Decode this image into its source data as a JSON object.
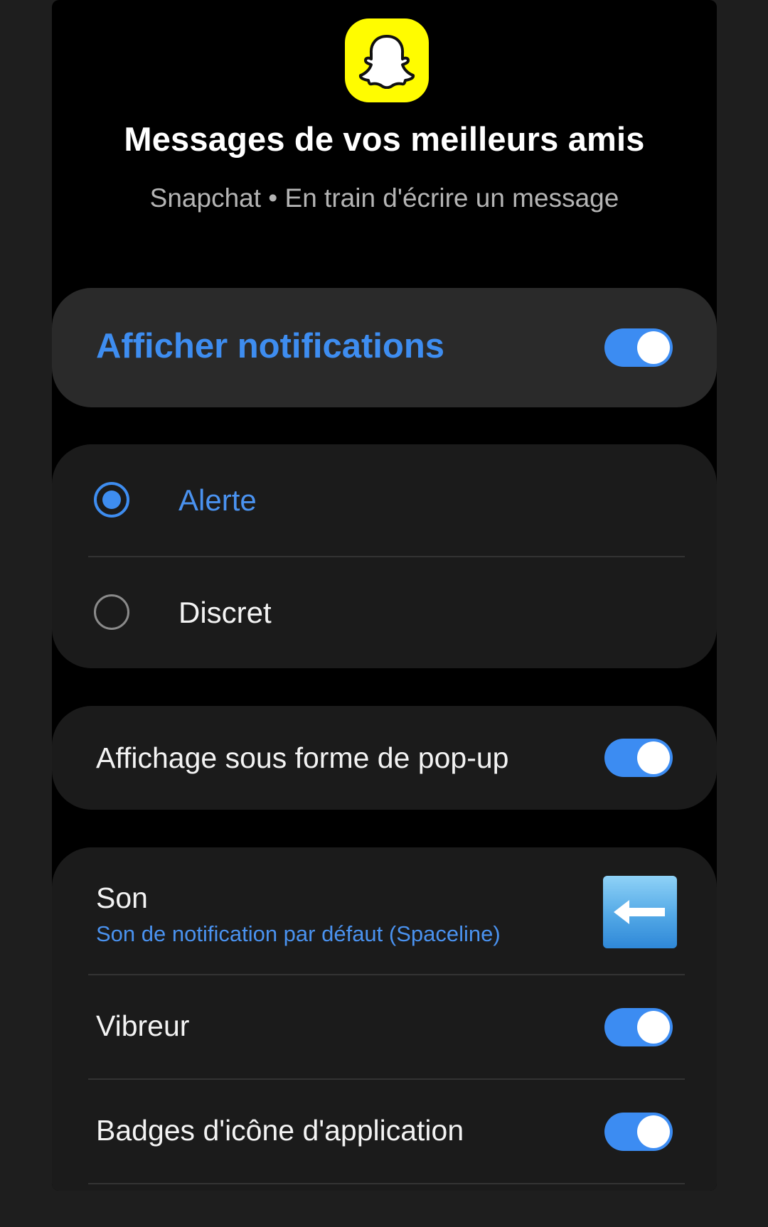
{
  "app": {
    "name": "Snapchat",
    "icon": "snapchat-ghost-icon",
    "brand_color": "#fffc00"
  },
  "header": {
    "title": "Messages de vos meilleurs amis",
    "subtitle": "Snapchat • En train d'écrire un message"
  },
  "master_toggle": {
    "label": "Afficher notifications",
    "on": true
  },
  "alert_mode": {
    "options": [
      {
        "label": "Alerte",
        "selected": true
      },
      {
        "label": "Discret",
        "selected": false
      }
    ]
  },
  "popup": {
    "label": "Affichage sous forme de pop-up",
    "on": true
  },
  "sound": {
    "label": "Son",
    "value": "Son de notification par défaut (Spaceline)",
    "icon": "left-arrow-emoji-icon"
  },
  "vibration": {
    "label": "Vibreur",
    "on": true
  },
  "badges": {
    "label": "Badges d'icône d'application",
    "on": true
  },
  "colors": {
    "accent": "#3e8df0",
    "background": "#000000",
    "card": "#1b1b1b"
  }
}
